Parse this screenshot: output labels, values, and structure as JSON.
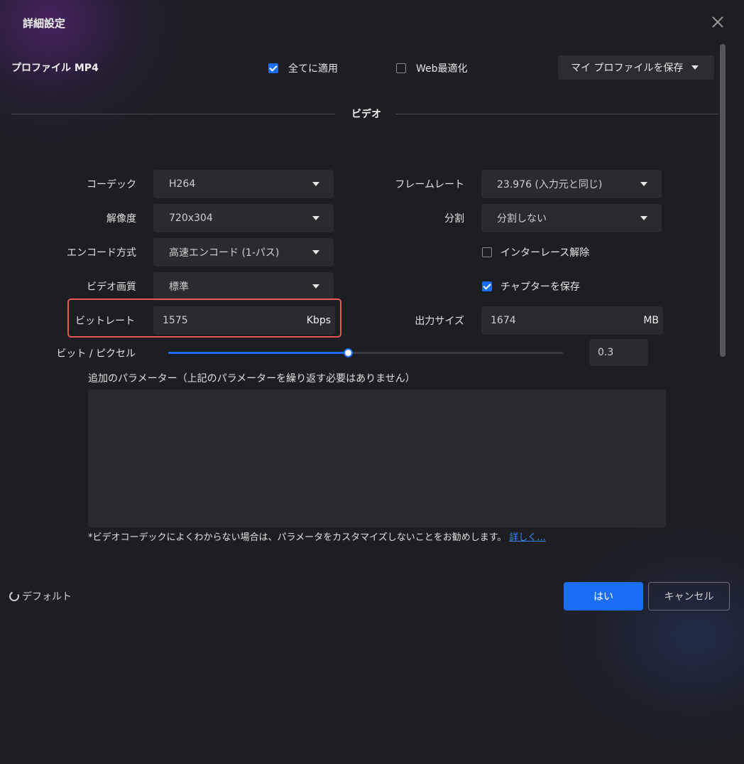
{
  "window": {
    "title": "詳細設定"
  },
  "profile": {
    "label": "プロファイル MP4",
    "apply_all": {
      "label": "全てに適用",
      "checked": true
    },
    "web_optimize": {
      "label": "Web最適化",
      "checked": false
    },
    "save_profile_label": "マイ プロファイルを保存"
  },
  "video": {
    "section_title": "ビデオ",
    "codec": {
      "label": "コーデック",
      "value": "H264"
    },
    "resolution": {
      "label": "解像度",
      "value": "720x304"
    },
    "encode_method": {
      "label": "エンコード方式",
      "value": "高速エンコード (1-パス)"
    },
    "quality": {
      "label": "ビデオ画質",
      "value": "標準"
    },
    "bitrate": {
      "label": "ビットレート",
      "value": "1575",
      "unit": "Kbps"
    },
    "frame_rate": {
      "label": "フレームレート",
      "value": "23.976 (入力元と同じ)"
    },
    "split": {
      "label": "分割",
      "value": "分割しない"
    },
    "deinterlace": {
      "label": "インターレース解除",
      "checked": false
    },
    "save_chapters": {
      "label": "チャプターを保存",
      "checked": true
    },
    "output_size": {
      "label": "出力サイズ",
      "value": "1674",
      "unit": "MB"
    },
    "bits_per_pixel": {
      "label": "ビット / ピクセル",
      "value": "0.3",
      "slider_fraction": 0.455
    }
  },
  "params": {
    "label": "追加のパラメーター（上記のパラメーターを繰り返す必要はありません）",
    "value": "",
    "note": "*ビデオコーデックによくわからない場合は、パラメータをカスタマイズしないことをお勧めします。",
    "link": "詳しく..."
  },
  "footer": {
    "default_label": "デフォルト",
    "ok_label": "はい",
    "cancel_label": "キャンセル"
  },
  "colors": {
    "accent": "#1a6df5",
    "highlight_border": "#e65a55",
    "background": "#1d1e22",
    "field": "#2a2b2f"
  }
}
